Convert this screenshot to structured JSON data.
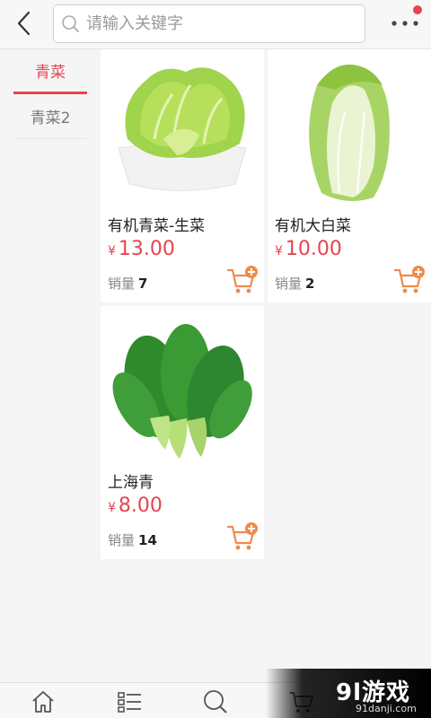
{
  "header": {
    "search_placeholder": "请输入关键字"
  },
  "sidebar": {
    "items": [
      {
        "label": "青菜",
        "active": true
      },
      {
        "label": "青菜2",
        "active": false
      }
    ]
  },
  "products": [
    {
      "name": "有机青菜-生菜",
      "currency": "¥",
      "price": "13.00",
      "sales_label": "销量",
      "sales": "7"
    },
    {
      "name": "有机大白菜",
      "currency": "¥",
      "price": "10.00",
      "sales_label": "销量",
      "sales": "2"
    },
    {
      "name": "上海青",
      "currency": "¥",
      "price": "8.00",
      "sales_label": "销量",
      "sales": "14"
    }
  ],
  "watermark": {
    "logo": "9l游戏",
    "url": "91danji.com"
  },
  "colors": {
    "accent": "#e8434f",
    "cart": "#f08a4b"
  }
}
